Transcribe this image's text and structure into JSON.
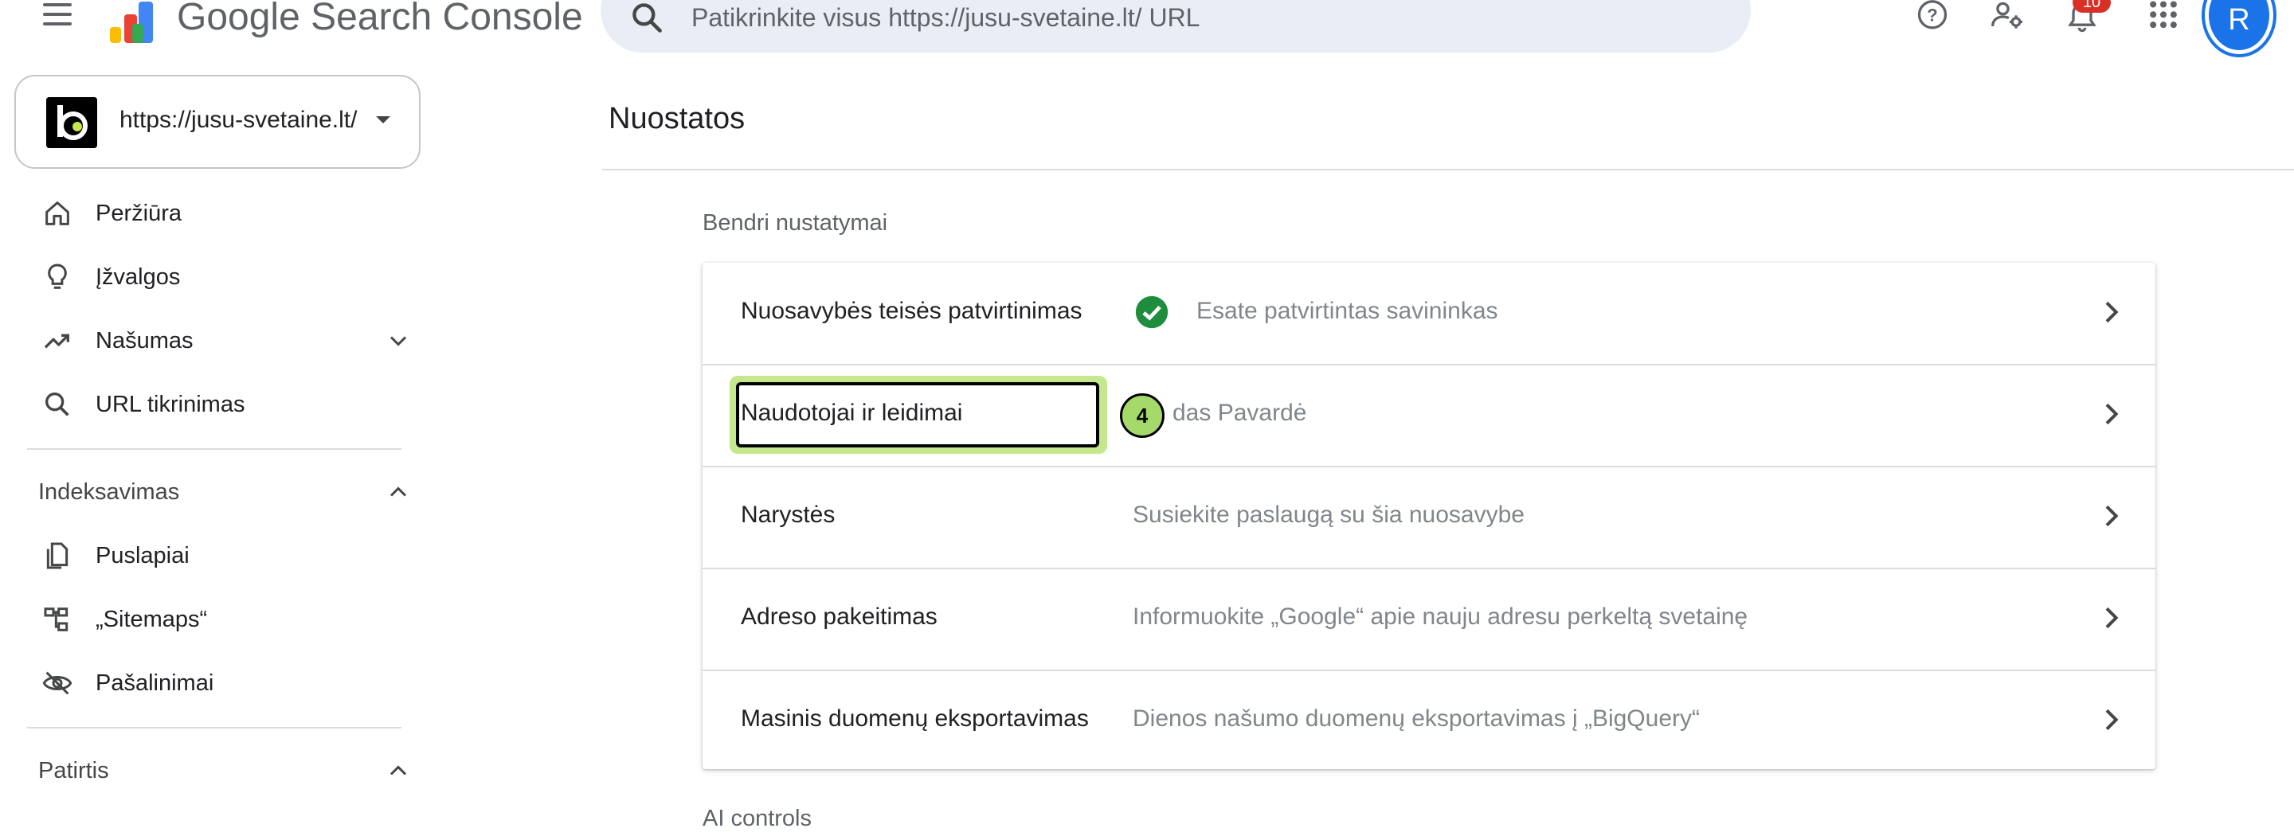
{
  "app": {
    "brand": "Google Search Console",
    "search_placeholder": "Patikrinkite visus https://jusu-svetaine.lt/ URL",
    "notifications_count": "10",
    "avatar_initial": "R"
  },
  "property": {
    "url": "https://jusu-svetaine.lt/"
  },
  "sidebar": {
    "items": [
      {
        "label": "Peržiūra",
        "icon": "home-icon"
      },
      {
        "label": "Įžvalgos",
        "icon": "lightbulb-icon"
      },
      {
        "label": "Našumas",
        "icon": "trending-up-icon"
      },
      {
        "label": "URL tikrinimas",
        "icon": "search-icon"
      }
    ],
    "sections": [
      {
        "label": "Indeksavimas",
        "items": [
          {
            "label": "Puslapiai",
            "icon": "pages-icon"
          },
          {
            "label": "„Sitemaps“",
            "icon": "sitemap-icon"
          },
          {
            "label": "Pašalinimai",
            "icon": "visibility-off-icon"
          }
        ]
      },
      {
        "label": "Patirtis"
      }
    ]
  },
  "main": {
    "title": "Nuostatos",
    "group_heading": "Bendri nustatymai",
    "rows": [
      {
        "title": "Nuosavybės teisės patvirtinimas",
        "value": "Esate patvirtintas savininkas"
      },
      {
        "title": "Naudotojai ir leidimai",
        "value": "das Pavardė"
      },
      {
        "title": "Narystės",
        "value": "Susiekite paslaugą su šia nuosavybe"
      },
      {
        "title": "Adreso pakeitimas",
        "value": "Informuokite „Google“ apie nauju adresu perkeltą svetainę"
      },
      {
        "title": "Masinis duomenų eksportavimas",
        "value": "Dienos našumo duomenų eksportavimas į „BigQuery“"
      }
    ],
    "next_heading": "AI controls"
  },
  "annotation": {
    "step_number": "4"
  },
  "colors": {
    "accent": "#1a73e8",
    "search_bg": "#e9eef6",
    "verified_green": "#1e8e3e",
    "highlight_green": "#c5e88f",
    "badge_red": "#d93025"
  }
}
